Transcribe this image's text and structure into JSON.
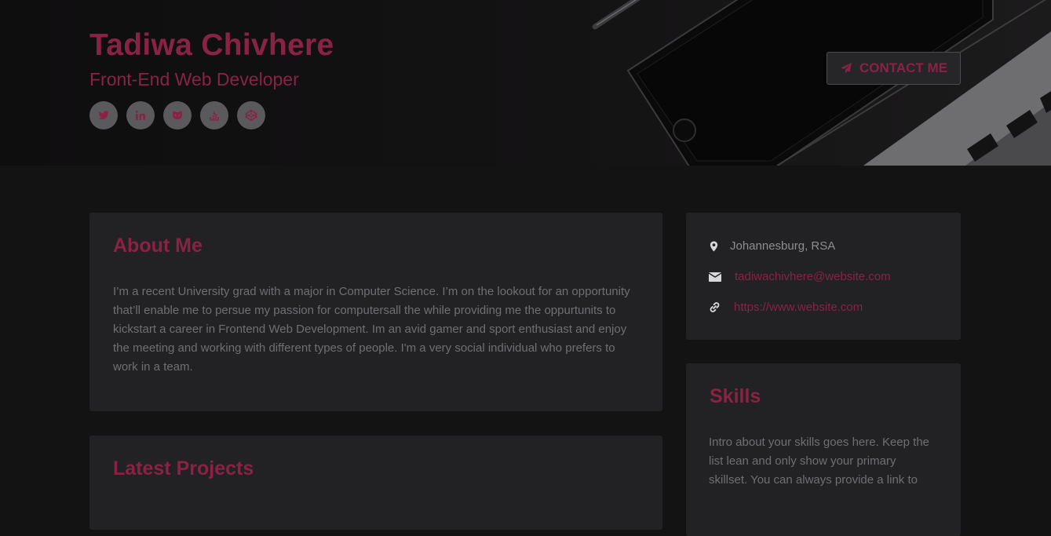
{
  "header": {
    "name": "Tadiwa Chivhere",
    "tagline": "Front-End Web Developer",
    "contact_label": "CONTACT ME",
    "social_links": [
      {
        "icon": "twitter-icon"
      },
      {
        "icon": "linkedin-icon"
      },
      {
        "icon": "github-icon"
      },
      {
        "icon": "stackoverflow-icon"
      },
      {
        "icon": "codepen-icon"
      }
    ]
  },
  "about": {
    "title": "About Me",
    "text": "I’m a recent University grad with a major in Computer Science. I’m on the lookout for an opportunity that’ll enable me to persue my passion for computersall the while providing me the oppurtunits to kickstart a career in Frontend Web Development. Im an avid gamer and sport enthusiast and enjoy the meeting and working with different types of people. I'm a very social individual who prefers to work in a team."
  },
  "projects": {
    "title": "Latest Projects"
  },
  "info": {
    "location": "Johannesburg, RSA",
    "email": "tadiwachivhere@website.com",
    "website": "https://www.website.com"
  },
  "skills": {
    "title": "Skills",
    "intro": "Intro about your skills goes here. Keep the list lean and only show your primary skillset. You can always provide a link to"
  },
  "colors": {
    "accent": "#8a2244",
    "background": "#141314",
    "card": "#222123",
    "text": "#6f6f74"
  }
}
